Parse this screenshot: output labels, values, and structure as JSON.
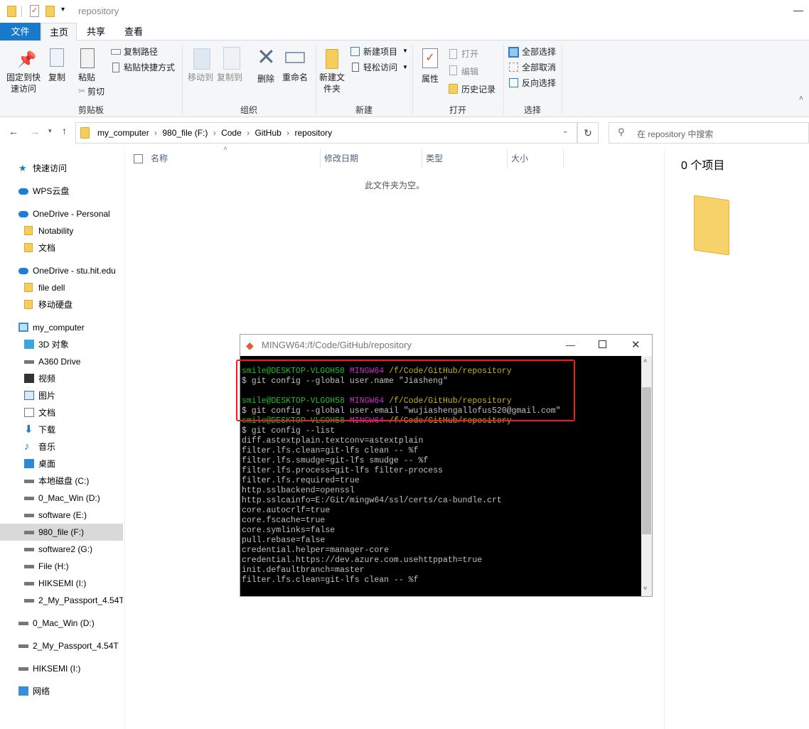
{
  "window": {
    "title": "repository"
  },
  "tabs": [
    {
      "label": "文件",
      "active": false
    },
    {
      "label": "主页",
      "active": true
    },
    {
      "label": "共享"
    },
    {
      "label": "查看"
    }
  ],
  "ribbon": {
    "clipboard": {
      "label": "剪贴板",
      "pin": "固定到快速访问",
      "copy": "复制",
      "paste": "粘贴",
      "copy_path": "复制路径",
      "paste_shortcut": "粘贴快捷方式",
      "cut": "剪切"
    },
    "organize": {
      "label": "组织",
      "move_to": "移动到",
      "copy_to": "复制到",
      "delete": "删除",
      "rename": "重命名"
    },
    "new": {
      "label": "新建",
      "new_folder": "新建文件夹",
      "new_item": "新建项目",
      "easy_access": "轻松访问"
    },
    "open": {
      "label": "打开",
      "properties": "属性",
      "open": "打开",
      "edit": "编辑",
      "history": "历史记录"
    },
    "select": {
      "label": "选择",
      "select_all": "全部选择",
      "select_none": "全部取消",
      "invert": "反向选择"
    }
  },
  "address": {
    "crumbs": [
      "my_computer",
      "980_file (F:)",
      "Code",
      "GitHub",
      "repository"
    ],
    "search_placeholder": "在 repository 中搜索"
  },
  "columns": [
    "名称",
    "修改日期",
    "类型",
    "大小"
  ],
  "empty_message": "此文件夹为空。",
  "details": {
    "count": "0 个项目"
  },
  "sidebar": [
    {
      "label": "快速访问",
      "icon": "star-icon",
      "level": 0
    },
    {
      "label": "WPS云盘",
      "icon": "cloud-icon",
      "level": 0
    },
    {
      "label": "OneDrive - Personal",
      "icon": "cloud-icon",
      "level": 0
    },
    {
      "label": "Notability",
      "icon": "folder-icon",
      "level": 1
    },
    {
      "label": "文档",
      "icon": "folder-icon",
      "level": 1
    },
    {
      "label": "OneDrive - stu.hit.edu",
      "icon": "cloud-icon",
      "level": 0
    },
    {
      "label": "file dell",
      "icon": "folder-icon",
      "level": 1
    },
    {
      "label": "移动硬盘",
      "icon": "folder-icon",
      "level": 1
    },
    {
      "label": "my_computer",
      "icon": "computer-icon",
      "level": 0
    },
    {
      "label": "3D 对象",
      "icon": "cube-icon",
      "level": 1
    },
    {
      "label": "A360 Drive",
      "icon": "drive-icon",
      "level": 1
    },
    {
      "label": "视频",
      "icon": "video-icon",
      "level": 1
    },
    {
      "label": "图片",
      "icon": "picture-icon",
      "level": 1
    },
    {
      "label": "文档",
      "icon": "document-icon",
      "level": 1
    },
    {
      "label": "下载",
      "icon": "download-icon",
      "level": 1
    },
    {
      "label": "音乐",
      "icon": "music-icon",
      "level": 1
    },
    {
      "label": "桌面",
      "icon": "desktop-icon",
      "level": 1
    },
    {
      "label": "本地磁盘 (C:)",
      "icon": "drive-icon",
      "level": 1
    },
    {
      "label": "0_Mac_Win (D:)",
      "icon": "drive-icon",
      "level": 1
    },
    {
      "label": "software (E:)",
      "icon": "drive-icon",
      "level": 1
    },
    {
      "label": "980_file (F:)",
      "icon": "drive-icon",
      "level": 1,
      "selected": true
    },
    {
      "label": "software2 (G:)",
      "icon": "drive-icon",
      "level": 1
    },
    {
      "label": "File (H:)",
      "icon": "drive-icon",
      "level": 1
    },
    {
      "label": "HIKSEMI (I:)",
      "icon": "drive-icon",
      "level": 1
    },
    {
      "label": "2_My_Passport_4.54T",
      "icon": "drive-icon",
      "level": 1
    },
    {
      "label": "0_Mac_Win (D:)",
      "icon": "drive-icon",
      "level": 0
    },
    {
      "label": "2_My_Passport_4.54T",
      "icon": "drive-icon",
      "level": 0
    },
    {
      "label": "HIKSEMI (I:)",
      "icon": "drive-icon",
      "level": 0
    },
    {
      "label": "网络",
      "icon": "network-icon",
      "level": 0
    }
  ],
  "terminal": {
    "title": "MINGW64:/f/Code/GitHub/repository",
    "prompt_user": "smile@DESKTOP-VLGOH58",
    "prompt_env": "MINGW64",
    "prompt_path": "/f/Code/GitHub/repository",
    "cmd1": "$ git config --global user.name \"Jiasheng\"",
    "cmd2": "$ git config --global user.email \"wujiashengallofus520@gmail.com\"",
    "cmd3": "$ git config --list",
    "output": [
      "diff.astextplain.textconv=astextplain",
      "filter.lfs.clean=git-lfs clean -- %f",
      "filter.lfs.smudge=git-lfs smudge -- %f",
      "filter.lfs.process=git-lfs filter-process",
      "filter.lfs.required=true",
      "http.sslbackend=openssl",
      "http.sslcainfo=E:/Git/mingw64/ssl/certs/ca-bundle.crt",
      "core.autocrlf=true",
      "core.fscache=true",
      "core.symlinks=false",
      "pull.rebase=false",
      "credential.helper=manager-core",
      "credential.https://dev.azure.com.usehttppath=true",
      "init.defaultbranch=master",
      "filter.lfs.clean=git-lfs clean -- %f"
    ]
  },
  "colors": {
    "accent": "#1979ca",
    "highlight": "#ee1c1c",
    "prompt_green": "#25bc24",
    "prompt_magenta": "#c930c7",
    "prompt_yellow": "#c6b218"
  }
}
